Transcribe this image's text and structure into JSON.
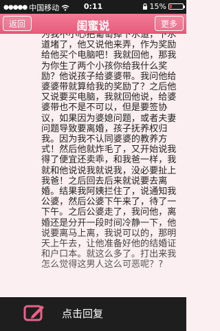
{
  "status_bar": {
    "carrier": "中国移动",
    "time": "0:11",
    "battery": "15%",
    "battery_level": 0.15
  },
  "nav": {
    "title": "闺蜜说",
    "back_label": "返回",
    "more_label": "更多"
  },
  "post": {
    "body": "为我不小心把葡萄掉下水道，下水道堵了，他又说他来弄，作为奖励给他买个电脑吧！我就回他，那我为你生了两个小孩你给我什么奖励？他说孩子给婆婆带。我问他给婆婆带就算给我的奖励了？之后他又说要买电脑，我就回他说，给婆婆带也不是不可以，但是要签协议，如果因为婆媳问题，或者夫妻问题导致要离婚，孩子抚养权归我。因为我不认同婆婆的教养方式！然后他就炸毛了，又开始说我得了便宜还卖乖，和我爸一样，我就和他说说我就说我，没必要扯上我爸！之后回去后来就说要去离婚。结果我阿姨拦住了，说通知我公婆，然后公婆下午来了，待了一下午。之后公婆走了，我问他，离婚还是分开一段时间冷静一下，他说要离马上离，我说可以的，那明天上午去，让他准备好他的结婚证和户口本。就这么多了。打出来我怎么觉得这男人这么可恶呢？?"
  },
  "bottom_bar": {
    "reply_label": "点击回复"
  }
}
